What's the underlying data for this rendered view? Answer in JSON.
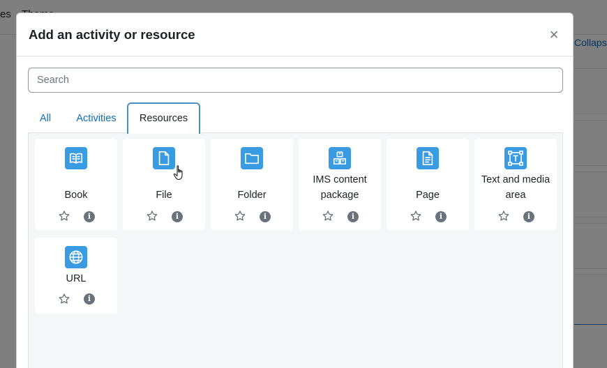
{
  "background": {
    "nav_items": [
      "es",
      "Theme"
    ],
    "collapse_label": "Collaps"
  },
  "modal": {
    "title": "Add an activity or resource",
    "close_symbol": "×",
    "search_placeholder": "Search",
    "search_value": "",
    "tabs": [
      {
        "label": "All",
        "active": false
      },
      {
        "label": "Activities",
        "active": false
      },
      {
        "label": "Resources",
        "active": true
      }
    ],
    "items": [
      {
        "label": "Book",
        "icon": "book-icon"
      },
      {
        "label": "File",
        "icon": "file-icon"
      },
      {
        "label": "Folder",
        "icon": "folder-icon"
      },
      {
        "label": "IMS content package",
        "icon": "ims-package-icon"
      },
      {
        "label": "Page",
        "icon": "page-icon"
      },
      {
        "label": "Text and media area",
        "icon": "text-media-icon"
      },
      {
        "label": "URL",
        "icon": "globe-icon"
      }
    ]
  },
  "colors": {
    "accent": "#0f6cbf",
    "icon_bg": "#399be2",
    "active_tab_border": "#4a90c8",
    "panel_bg": "#f5f6f7"
  }
}
